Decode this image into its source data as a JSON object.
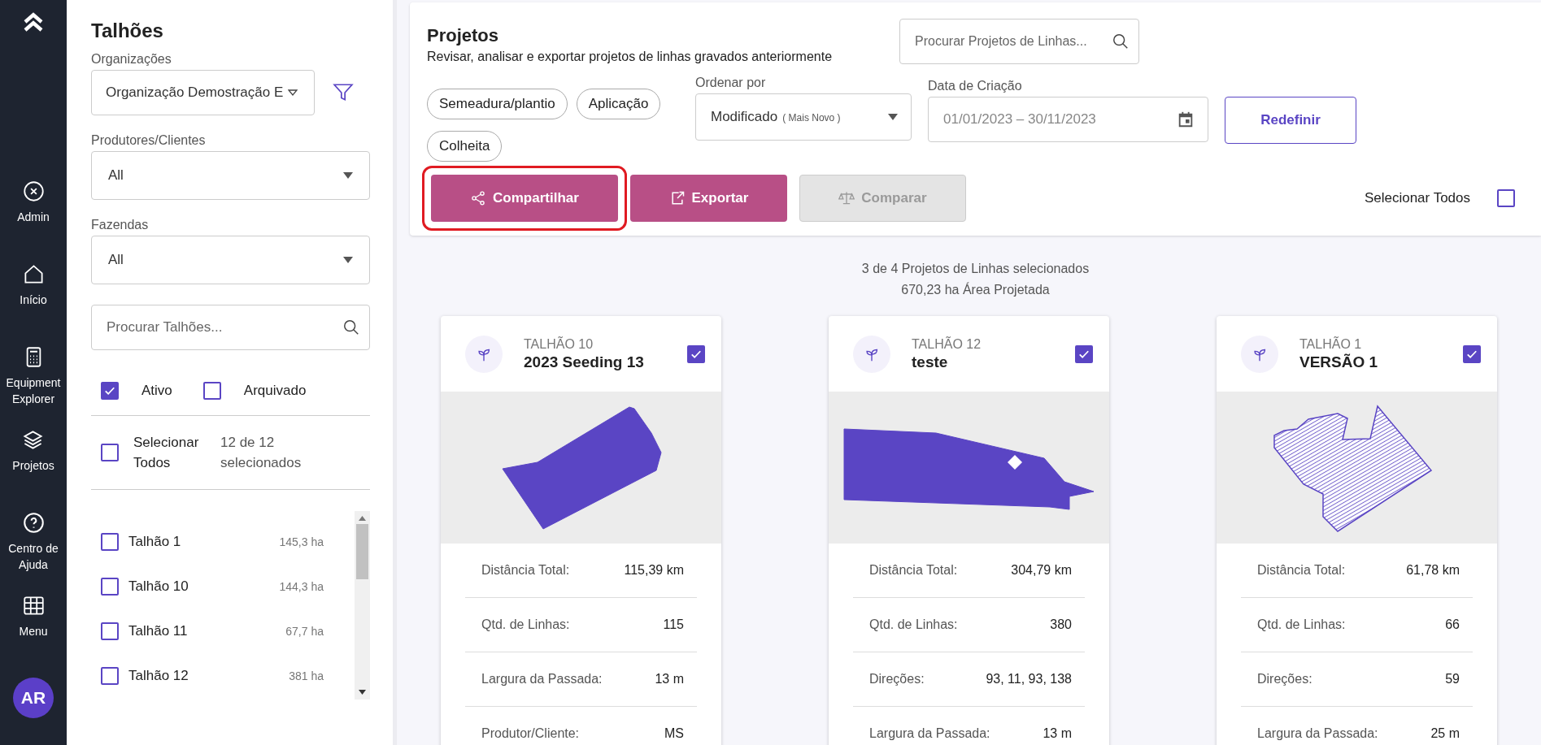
{
  "nav": {
    "items": [
      {
        "kind": "admin",
        "label": "Admin"
      },
      {
        "kind": "home",
        "label": "Início"
      },
      {
        "kind": "calculator",
        "label": "Equipment Explorer"
      },
      {
        "kind": "layers",
        "label": "Projetos"
      },
      {
        "kind": "help",
        "label": "Centro de Ajuda"
      },
      {
        "kind": "grid",
        "label": "Menu"
      }
    ],
    "avatar": "AR"
  },
  "sidebar": {
    "title": "Talhões",
    "organization": {
      "label": "Organizações",
      "value": "Organização Demostração E"
    },
    "producers": {
      "label": "Produtores/Clientes",
      "value": "All"
    },
    "farms": {
      "label": "Fazendas",
      "value": "All"
    },
    "search": {
      "placeholder": "Procurar Talhões..."
    },
    "status_filters": [
      {
        "label": "Ativo",
        "checked": true
      },
      {
        "label": "Arquivado",
        "checked": false
      }
    ],
    "select_all": {
      "label": "Selecionar Todos",
      "checked": false,
      "count": "12 de 12 selecionados"
    },
    "fields": [
      {
        "name": "Talhão 1",
        "area": "145,3 ha",
        "checked": false
      },
      {
        "name": "Talhão 10",
        "area": "144,3 ha",
        "checked": false
      },
      {
        "name": "Talhão 11",
        "area": "67,7 ha",
        "checked": false
      },
      {
        "name": "Talhão 12",
        "area": "381 ha",
        "checked": false
      }
    ]
  },
  "header": {
    "title": "Projetos",
    "subtitle": "Revisar, analisar e exportar projetos de linhas gravados anteriormente",
    "search": {
      "placeholder": "Procurar Projetos de Linhas..."
    },
    "chips": [
      "Semeadura/plantio",
      "Aplicação",
      "Colheita"
    ],
    "sort": {
      "label": "Ordenar por",
      "value": "Modificado",
      "hint": "( Mais Novo )"
    },
    "date": {
      "label": "Data de Criação",
      "value": "01/01/2023 – 30/11/2023"
    },
    "reset": "Redefinir",
    "actions": [
      {
        "kind": "share",
        "label": "Compartilhar",
        "disabled": false,
        "highlighted": true
      },
      {
        "kind": "export",
        "label": "Exportar",
        "disabled": false,
        "highlighted": false
      },
      {
        "kind": "compare",
        "label": "Comparar",
        "disabled": true,
        "highlighted": false
      }
    ],
    "select_all": {
      "label": "Selecionar Todos",
      "checked": false
    }
  },
  "summary": [
    "3 de 4 Projetos de Linhas selecionados",
    "670,23 ha Área Projetada"
  ],
  "cards": [
    {
      "field": "TALHÃO 10",
      "name": "2023 Seeding 13",
      "checked": true,
      "stats": [
        {
          "label": "Distância Total:",
          "value": "115,39 km"
        },
        {
          "label": "Qtd. de Linhas:",
          "value": "115"
        },
        {
          "label": "Largura da Passada:",
          "value": "13 m"
        },
        {
          "label": "Produtor/Cliente:",
          "value": "MS"
        }
      ]
    },
    {
      "field": "TALHÃO 12",
      "name": "teste",
      "checked": true,
      "stats": [
        {
          "label": "Distância Total:",
          "value": "304,79 km"
        },
        {
          "label": "Qtd. de Linhas:",
          "value": "380"
        },
        {
          "label": "Direções:",
          "value": "93, 11, 93, 138"
        },
        {
          "label": "Largura da Passada:",
          "value": "13 m"
        }
      ]
    },
    {
      "field": "TALHÃO 1",
      "name": "VERSÃO 1",
      "checked": true,
      "stats": [
        {
          "label": "Distância Total:",
          "value": "61,78 km"
        },
        {
          "label": "Qtd. de Linhas:",
          "value": "66"
        },
        {
          "label": "Direções:",
          "value": "59"
        },
        {
          "label": "Largura da Passada:",
          "value": "25 m"
        }
      ]
    }
  ]
}
